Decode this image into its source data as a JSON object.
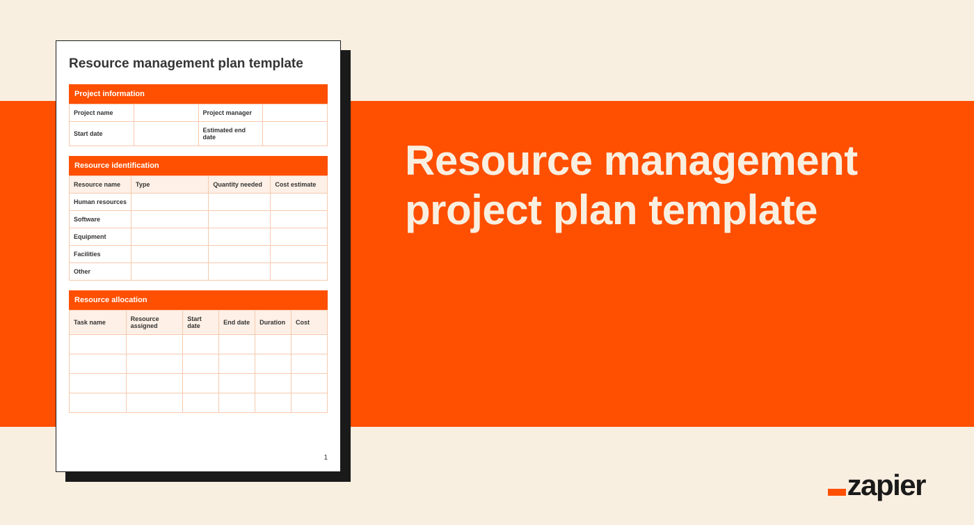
{
  "headline": "Resource management project plan template",
  "logo": {
    "text": "zapier"
  },
  "document": {
    "title": "Resource management plan template",
    "page_number": "1",
    "sections": {
      "project_info": {
        "header": "Project information",
        "fields": {
          "project_name": "Project name",
          "project_manager": "Project manager",
          "start_date": "Start date",
          "estimated_end_date": "Estimated end date"
        }
      },
      "resource_id": {
        "header": "Resource identification",
        "columns": {
          "resource_name": "Resource name",
          "type": "Type",
          "quantity_needed": "Quantity needed",
          "cost_estimate": "Cost estimate"
        },
        "rows": [
          "Human resources",
          "Software",
          "Equipment",
          "Facilities",
          "Other"
        ]
      },
      "resource_alloc": {
        "header": "Resource allocation",
        "columns": {
          "task_name": "Task name",
          "resource_assigned": "Resource assigned",
          "start_date": "Start date",
          "end_date": "End date",
          "duration": "Duration",
          "cost": "Cost"
        }
      }
    }
  }
}
